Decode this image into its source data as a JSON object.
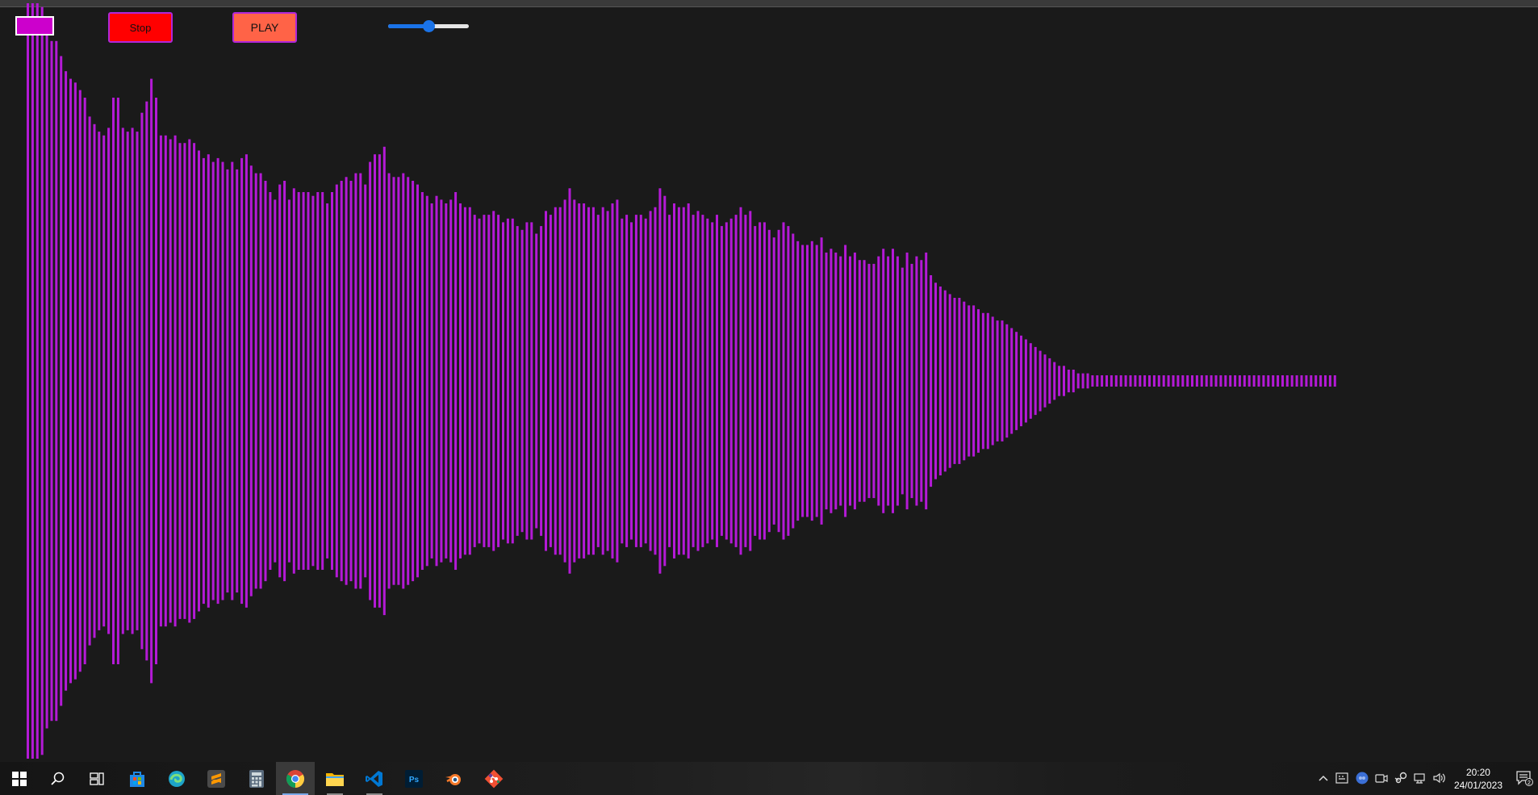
{
  "controls": {
    "color_swatch": "#cc00cc",
    "stop_label": "Stop",
    "stop_color": "#ff0000",
    "play_label": "PLAY",
    "play_color": "#ff6347",
    "volume_fraction": 0.5
  },
  "visualizer": {
    "bar_color": "#b41ad6",
    "background": "#1a1a1a",
    "amplitudes": [
      1,
      1,
      1,
      0.99,
      0.92,
      0.9,
      0.9,
      0.86,
      0.82,
      0.8,
      0.79,
      0.77,
      0.75,
      0.7,
      0.68,
      0.66,
      0.65,
      0.67,
      0.75,
      0.75,
      0.67,
      0.66,
      0.67,
      0.66,
      0.71,
      0.74,
      0.8,
      0.75,
      0.65,
      0.65,
      0.64,
      0.65,
      0.63,
      0.63,
      0.64,
      0.63,
      0.61,
      0.59,
      0.6,
      0.58,
      0.59,
      0.58,
      0.56,
      0.58,
      0.56,
      0.59,
      0.6,
      0.57,
      0.55,
      0.55,
      0.53,
      0.5,
      0.48,
      0.52,
      0.53,
      0.48,
      0.51,
      0.5,
      0.5,
      0.5,
      0.49,
      0.5,
      0.5,
      0.47,
      0.5,
      0.52,
      0.53,
      0.54,
      0.53,
      0.55,
      0.55,
      0.52,
      0.58,
      0.6,
      0.6,
      0.62,
      0.55,
      0.54,
      0.54,
      0.55,
      0.54,
      0.53,
      0.52,
      0.5,
      0.49,
      0.47,
      0.49,
      0.48,
      0.47,
      0.48,
      0.5,
      0.47,
      0.46,
      0.46,
      0.44,
      0.43,
      0.44,
      0.44,
      0.45,
      0.44,
      0.42,
      0.43,
      0.43,
      0.41,
      0.4,
      0.42,
      0.42,
      0.39,
      0.41,
      0.45,
      0.44,
      0.46,
      0.46,
      0.48,
      0.51,
      0.48,
      0.47,
      0.47,
      0.46,
      0.46,
      0.44,
      0.46,
      0.45,
      0.47,
      0.48,
      0.43,
      0.44,
      0.42,
      0.44,
      0.44,
      0.43,
      0.45,
      0.46,
      0.51,
      0.49,
      0.44,
      0.47,
      0.46,
      0.46,
      0.47,
      0.44,
      0.45,
      0.44,
      0.43,
      0.42,
      0.44,
      0.41,
      0.42,
      0.43,
      0.44,
      0.46,
      0.44,
      0.45,
      0.41,
      0.42,
      0.42,
      0.4,
      0.38,
      0.4,
      0.42,
      0.41,
      0.39,
      0.37,
      0.36,
      0.36,
      0.37,
      0.36,
      0.38,
      0.34,
      0.35,
      0.34,
      0.33,
      0.36,
      0.33,
      0.34,
      0.32,
      0.32,
      0.31,
      0.31,
      0.33,
      0.35,
      0.33,
      0.35,
      0.33,
      0.3,
      0.34,
      0.31,
      0.33,
      0.32,
      0.34,
      0.28,
      0.26,
      0.25,
      0.24,
      0.23,
      0.22,
      0.22,
      0.21,
      0.2,
      0.2,
      0.19,
      0.18,
      0.18,
      0.17,
      0.16,
      0.16,
      0.15,
      0.14,
      0.13,
      0.12,
      0.11,
      0.1,
      0.09,
      0.08,
      0.07,
      0.06,
      0.05,
      0.04,
      0.04,
      0.03,
      0.03,
      0.02,
      0.02,
      0.02,
      0.015,
      0.015,
      0.015,
      0.015,
      0.015,
      0.015,
      0.015,
      0.015,
      0.015,
      0.015,
      0.015,
      0.015,
      0.015,
      0.015,
      0.015,
      0.015,
      0.015,
      0.015,
      0.015,
      0.015,
      0.015,
      0.015,
      0.015,
      0.015,
      0.015,
      0.015,
      0.015,
      0.015,
      0.015,
      0.015,
      0.015,
      0.015,
      0.015,
      0.015,
      0.015,
      0.015,
      0.015,
      0.015,
      0.015,
      0.015,
      0.015,
      0.015,
      0.015,
      0.015,
      0.015,
      0.015,
      0.015,
      0.015,
      0.015,
      0.015,
      0.015,
      0.015
    ]
  },
  "taskbar": {
    "apps": [
      {
        "name": "windows-start-icon"
      },
      {
        "name": "search-icon"
      },
      {
        "name": "task-view-icon"
      },
      {
        "name": "microsoft-store-icon"
      },
      {
        "name": "edge-browser-icon"
      },
      {
        "name": "sublime-text-icon"
      },
      {
        "name": "calculator-icon"
      },
      {
        "name": "chrome-icon",
        "active": true
      },
      {
        "name": "file-explorer-icon",
        "running": true
      },
      {
        "name": "vscode-icon",
        "running": true
      },
      {
        "name": "photoshop-icon",
        "label": "Ps"
      },
      {
        "name": "blender-icon"
      },
      {
        "name": "git-icon"
      }
    ],
    "tray_icons": [
      "chevron-up-icon",
      "keyboard-icon",
      "onedrive-icon",
      "camera-icon",
      "steam-icon",
      "network-icon",
      "volume-icon"
    ],
    "time": "20:20",
    "date": "24/01/2023",
    "notification_count": "2"
  }
}
